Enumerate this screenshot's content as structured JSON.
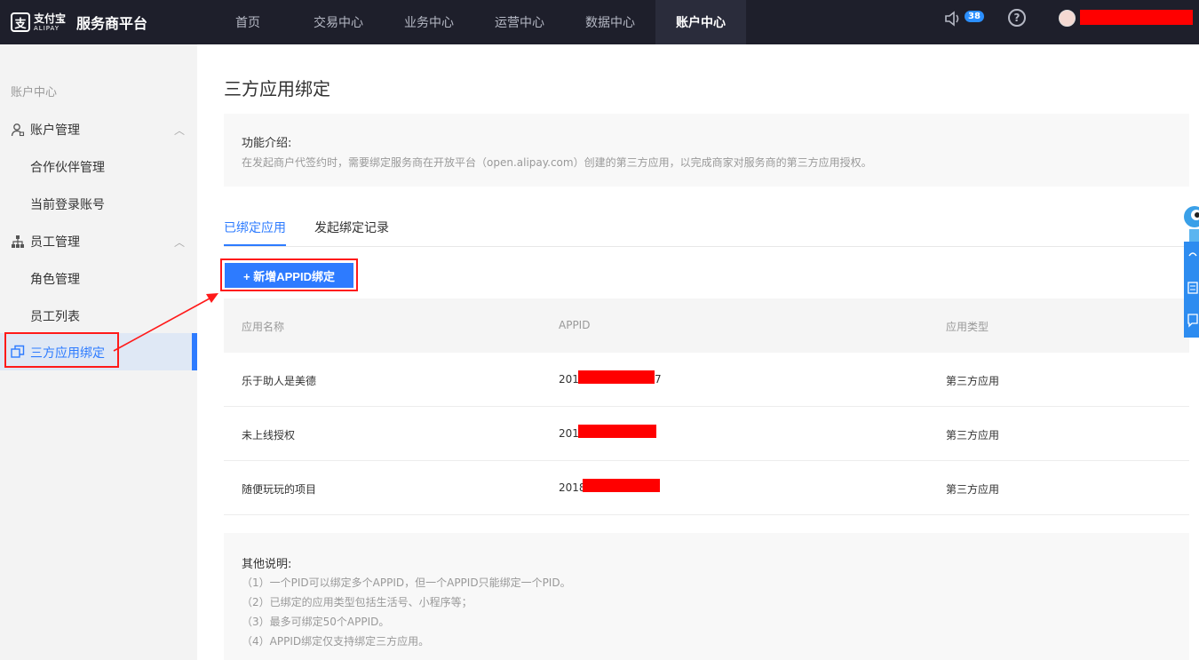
{
  "app": {
    "logo_cn": "支付宝",
    "logo_en": "ALIPAY",
    "title": "服务商平台"
  },
  "nav": {
    "items": [
      {
        "label": "首页"
      },
      {
        "label": "交易中心"
      },
      {
        "label": "业务中心"
      },
      {
        "label": "运营中心"
      },
      {
        "label": "数据中心"
      },
      {
        "label": "账户中心"
      }
    ],
    "active_index": 5
  },
  "header": {
    "notification_count": "38",
    "help_symbol": "?"
  },
  "sidebar": {
    "section_title": "账户中心",
    "groups": [
      {
        "label": "账户管理",
        "icon": "user-icon",
        "items": [
          {
            "label": "合作伙伴管理"
          },
          {
            "label": "当前登录账号"
          }
        ]
      },
      {
        "label": "员工管理",
        "icon": "org-chart-icon",
        "items": [
          {
            "label": "角色管理"
          },
          {
            "label": "员工列表"
          }
        ]
      }
    ],
    "active_item": {
      "label": "三方应用绑定",
      "icon": "copy-icon"
    }
  },
  "main": {
    "title": "三方应用绑定",
    "intro": {
      "title": "功能介绍:",
      "text": "在发起商户代签约时，需要绑定服务商在开放平台（open.alipay.com）创建的第三方应用，以完成商家对服务商的第三方应用授权。"
    },
    "tabs": [
      {
        "label": "已绑定应用"
      },
      {
        "label": "发起绑定记录"
      }
    ],
    "add_button": "+ 新增APPID绑定",
    "table": {
      "columns": [
        "应用名称",
        "APPID",
        "应用类型"
      ],
      "rows": [
        {
          "name": "乐于助人是美德",
          "appid_prefix": "201",
          "appid_suffix": "7",
          "type": "第三方应用"
        },
        {
          "name": "未上线授权",
          "appid_prefix": "201",
          "appid_suffix": "",
          "type": "第三方应用"
        },
        {
          "name": "随便玩玩的项目",
          "appid_prefix": "2018",
          "appid_suffix": "",
          "type": "第三方应用"
        }
      ]
    },
    "notes": {
      "title": "其他说明:",
      "lines": [
        "（1）一个PID可以绑定多个APPID，但一个APPID只能绑定一个PID。",
        "（2）已绑定的应用类型包括生活号、小程序等；",
        "（3）最多可绑定50个APPID。",
        "（4）APPID绑定仅支持绑定三方应用。"
      ]
    }
  },
  "colors": {
    "topbar": "#1e1f2b",
    "accent": "#2d7bff",
    "annotation_red": "#ff1a1a"
  }
}
